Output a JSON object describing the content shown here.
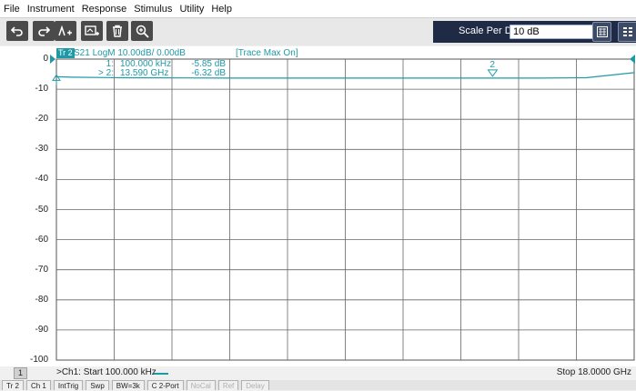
{
  "menu": [
    "File",
    "Instrument",
    "Response",
    "Stimulus",
    "Utility",
    "Help"
  ],
  "toolbar": {
    "buttons": [
      "undo-icon",
      "redo-icon",
      "add-trace-icon",
      "add-window-icon",
      "delete-icon",
      "zoom-icon"
    ],
    "scale_label": "Scale Per Division",
    "scale_value": "10 dB"
  },
  "trace": {
    "tag": "Tr 2",
    "title": "S21 LogM 10.00dB/ 0.00dB",
    "status": "[Trace Max On]",
    "color": "#1e9aa6"
  },
  "markers": [
    {
      "label": "1:",
      "freq": "100.000 kHz",
      "value": "-5.85 dB"
    },
    {
      "label": "> 2:",
      "freq": "13.590 GHz",
      "value": "-6.32 dB"
    }
  ],
  "marker_flag": "2",
  "chart_data": {
    "type": "line",
    "y_ticks": [
      "0",
      "-10",
      "-20",
      "-30",
      "-40",
      "-50",
      "-60",
      "-70",
      "-80",
      "-90",
      "-100"
    ],
    "ylim": [
      -100,
      0
    ],
    "x_range_label_start": ">Ch1: Start  100.000 kHz",
    "x_range_label_stop": "Stop  18.0000 GHz",
    "series": [
      {
        "x_ghz": [
          0.0001,
          0.5,
          2,
          4,
          6,
          8,
          10,
          12,
          13.59,
          15,
          16.5,
          18
        ],
        "y_db": [
          -5.85,
          -6.0,
          -6.2,
          -6.25,
          -6.3,
          -6.3,
          -6.3,
          -6.3,
          -6.32,
          -6.3,
          -6.2,
          -4.5
        ]
      }
    ]
  },
  "channel_number": "1",
  "statusbar": [
    {
      "label": "Tr 2",
      "enabled": true
    },
    {
      "label": "Ch 1",
      "enabled": true
    },
    {
      "label": "IntTrig",
      "enabled": true
    },
    {
      "label": "Swp",
      "enabled": true
    },
    {
      "label": "BW=3k",
      "enabled": true
    },
    {
      "label": "C 2-Port",
      "enabled": true
    },
    {
      "label": "NoCal",
      "enabled": false
    },
    {
      "label": "Ref",
      "enabled": false
    },
    {
      "label": "Delay",
      "enabled": false
    }
  ]
}
